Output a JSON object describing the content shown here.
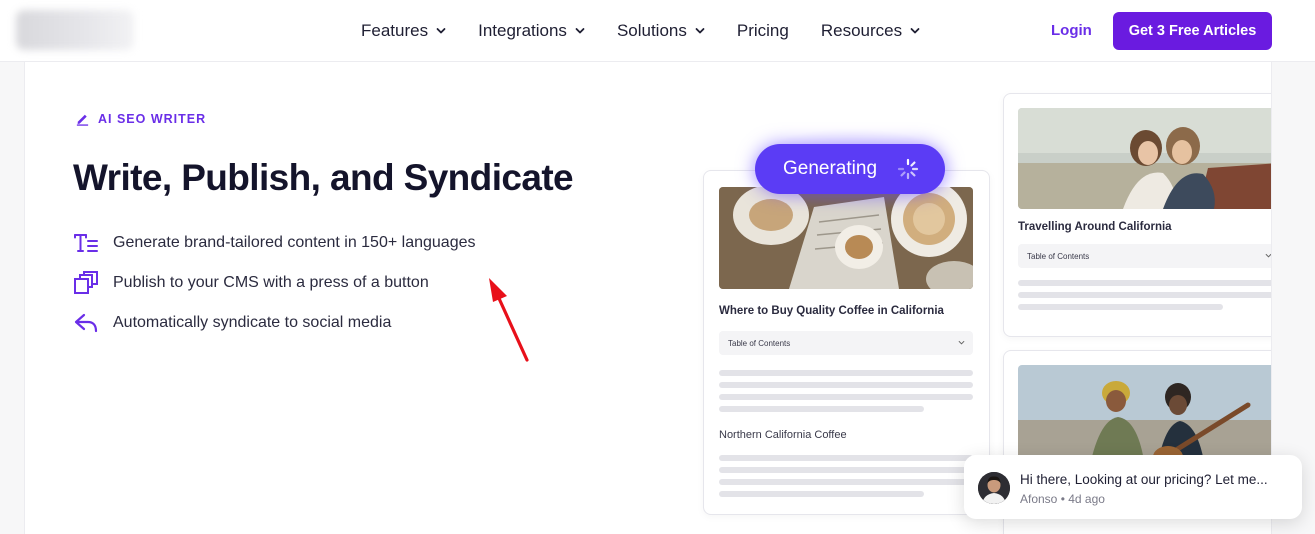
{
  "nav": {
    "menu": [
      {
        "label": "Features",
        "dropdown": true
      },
      {
        "label": "Integrations",
        "dropdown": true
      },
      {
        "label": "Solutions",
        "dropdown": true
      },
      {
        "label": "Pricing",
        "dropdown": false
      },
      {
        "label": "Resources",
        "dropdown": true
      }
    ],
    "login_label": "Login",
    "cta_label": "Get 3 Free Articles"
  },
  "hero": {
    "eyebrow": "AI SEO WRITER",
    "headline": "Write, Publish, and Syndicate",
    "features": [
      {
        "icon": "text-format-icon",
        "text": "Generate brand-tailored content in 150+ languages"
      },
      {
        "icon": "copy-stack-icon",
        "text": "Publish to your CMS with a press of a button"
      },
      {
        "icon": "share-reply-icon",
        "text": "Automatically syndicate to social media"
      }
    ]
  },
  "preview": {
    "generating_label": "Generating",
    "card1": {
      "title": "Where to Buy Quality Coffee in California",
      "toc_label": "Table of Contents",
      "subheading": "Northern California Coffee"
    },
    "card2": {
      "title": "Travelling Around California",
      "toc_label": "Table of Contents"
    }
  },
  "chat": {
    "message": "Hi there, Looking at our pricing? Let me...",
    "author": "Afonso",
    "time": "4d ago"
  },
  "colors": {
    "accent": "#6a1be0",
    "accent_text": "#6a2ee8",
    "generating_pill": "#5b3cf5",
    "annotation_arrow": "#e8101a"
  }
}
